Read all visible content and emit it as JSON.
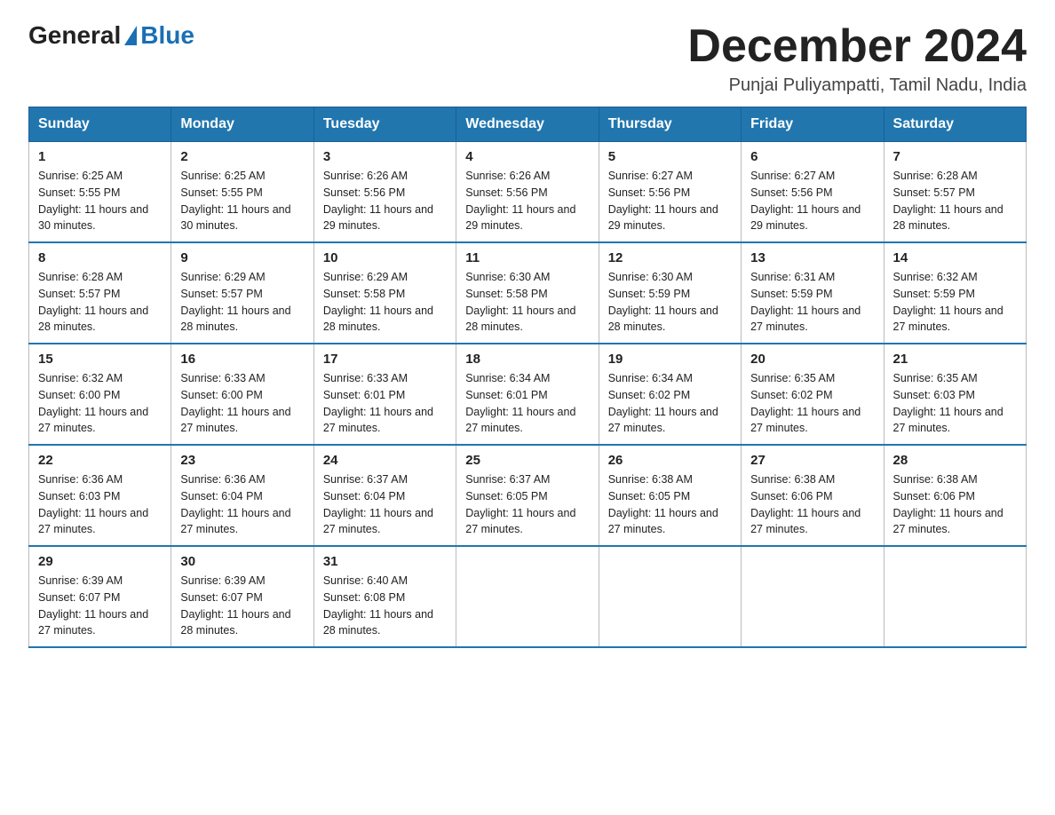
{
  "logo": {
    "general": "General",
    "blue": "Blue"
  },
  "title": "December 2024",
  "subtitle": "Punjai Puliyampatti, Tamil Nadu, India",
  "days_of_week": [
    "Sunday",
    "Monday",
    "Tuesday",
    "Wednesday",
    "Thursday",
    "Friday",
    "Saturday"
  ],
  "weeks": [
    [
      {
        "day": "1",
        "sunrise": "6:25 AM",
        "sunset": "5:55 PM",
        "daylight": "11 hours and 30 minutes."
      },
      {
        "day": "2",
        "sunrise": "6:25 AM",
        "sunset": "5:55 PM",
        "daylight": "11 hours and 30 minutes."
      },
      {
        "day": "3",
        "sunrise": "6:26 AM",
        "sunset": "5:56 PM",
        "daylight": "11 hours and 29 minutes."
      },
      {
        "day": "4",
        "sunrise": "6:26 AM",
        "sunset": "5:56 PM",
        "daylight": "11 hours and 29 minutes."
      },
      {
        "day": "5",
        "sunrise": "6:27 AM",
        "sunset": "5:56 PM",
        "daylight": "11 hours and 29 minutes."
      },
      {
        "day": "6",
        "sunrise": "6:27 AM",
        "sunset": "5:56 PM",
        "daylight": "11 hours and 29 minutes."
      },
      {
        "day": "7",
        "sunrise": "6:28 AM",
        "sunset": "5:57 PM",
        "daylight": "11 hours and 28 minutes."
      }
    ],
    [
      {
        "day": "8",
        "sunrise": "6:28 AM",
        "sunset": "5:57 PM",
        "daylight": "11 hours and 28 minutes."
      },
      {
        "day": "9",
        "sunrise": "6:29 AM",
        "sunset": "5:57 PM",
        "daylight": "11 hours and 28 minutes."
      },
      {
        "day": "10",
        "sunrise": "6:29 AM",
        "sunset": "5:58 PM",
        "daylight": "11 hours and 28 minutes."
      },
      {
        "day": "11",
        "sunrise": "6:30 AM",
        "sunset": "5:58 PM",
        "daylight": "11 hours and 28 minutes."
      },
      {
        "day": "12",
        "sunrise": "6:30 AM",
        "sunset": "5:59 PM",
        "daylight": "11 hours and 28 minutes."
      },
      {
        "day": "13",
        "sunrise": "6:31 AM",
        "sunset": "5:59 PM",
        "daylight": "11 hours and 27 minutes."
      },
      {
        "day": "14",
        "sunrise": "6:32 AM",
        "sunset": "5:59 PM",
        "daylight": "11 hours and 27 minutes."
      }
    ],
    [
      {
        "day": "15",
        "sunrise": "6:32 AM",
        "sunset": "6:00 PM",
        "daylight": "11 hours and 27 minutes."
      },
      {
        "day": "16",
        "sunrise": "6:33 AM",
        "sunset": "6:00 PM",
        "daylight": "11 hours and 27 minutes."
      },
      {
        "day": "17",
        "sunrise": "6:33 AM",
        "sunset": "6:01 PM",
        "daylight": "11 hours and 27 minutes."
      },
      {
        "day": "18",
        "sunrise": "6:34 AM",
        "sunset": "6:01 PM",
        "daylight": "11 hours and 27 minutes."
      },
      {
        "day": "19",
        "sunrise": "6:34 AM",
        "sunset": "6:02 PM",
        "daylight": "11 hours and 27 minutes."
      },
      {
        "day": "20",
        "sunrise": "6:35 AM",
        "sunset": "6:02 PM",
        "daylight": "11 hours and 27 minutes."
      },
      {
        "day": "21",
        "sunrise": "6:35 AM",
        "sunset": "6:03 PM",
        "daylight": "11 hours and 27 minutes."
      }
    ],
    [
      {
        "day": "22",
        "sunrise": "6:36 AM",
        "sunset": "6:03 PM",
        "daylight": "11 hours and 27 minutes."
      },
      {
        "day": "23",
        "sunrise": "6:36 AM",
        "sunset": "6:04 PM",
        "daylight": "11 hours and 27 minutes."
      },
      {
        "day": "24",
        "sunrise": "6:37 AM",
        "sunset": "6:04 PM",
        "daylight": "11 hours and 27 minutes."
      },
      {
        "day": "25",
        "sunrise": "6:37 AM",
        "sunset": "6:05 PM",
        "daylight": "11 hours and 27 minutes."
      },
      {
        "day": "26",
        "sunrise": "6:38 AM",
        "sunset": "6:05 PM",
        "daylight": "11 hours and 27 minutes."
      },
      {
        "day": "27",
        "sunrise": "6:38 AM",
        "sunset": "6:06 PM",
        "daylight": "11 hours and 27 minutes."
      },
      {
        "day": "28",
        "sunrise": "6:38 AM",
        "sunset": "6:06 PM",
        "daylight": "11 hours and 27 minutes."
      }
    ],
    [
      {
        "day": "29",
        "sunrise": "6:39 AM",
        "sunset": "6:07 PM",
        "daylight": "11 hours and 27 minutes."
      },
      {
        "day": "30",
        "sunrise": "6:39 AM",
        "sunset": "6:07 PM",
        "daylight": "11 hours and 28 minutes."
      },
      {
        "day": "31",
        "sunrise": "6:40 AM",
        "sunset": "6:08 PM",
        "daylight": "11 hours and 28 minutes."
      },
      null,
      null,
      null,
      null
    ]
  ]
}
